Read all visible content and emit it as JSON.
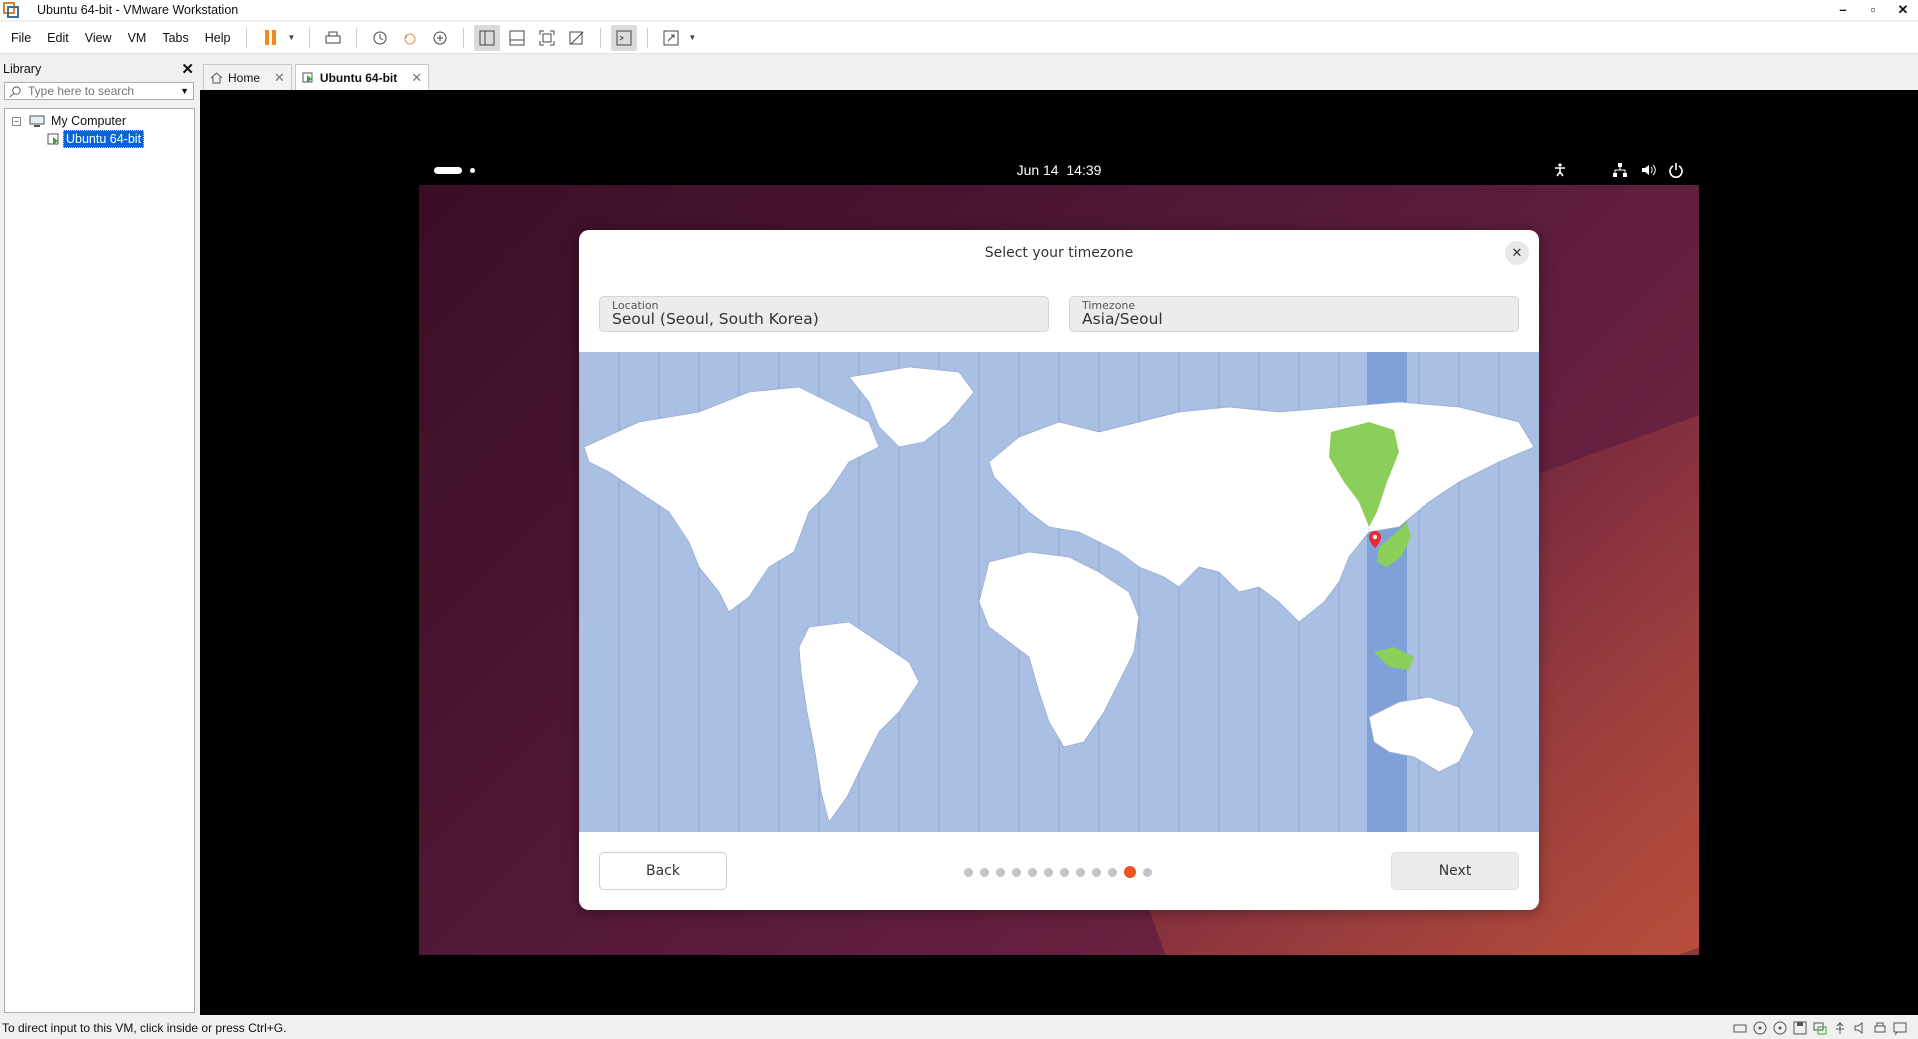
{
  "window": {
    "title": "Ubuntu 64-bit - VMware Workstation"
  },
  "menu": [
    "File",
    "Edit",
    "View",
    "VM",
    "Tabs",
    "Help"
  ],
  "library": {
    "title": "Library",
    "search_placeholder": "Type here to search",
    "tree": {
      "root": "My Computer",
      "child": "Ubuntu 64-bit"
    }
  },
  "tabs": [
    {
      "label": "Home"
    },
    {
      "label": "Ubuntu 64-bit"
    }
  ],
  "guest": {
    "topbar": {
      "date": "Jun 14",
      "time": "14:39"
    },
    "dialog": {
      "title": "Select your timezone",
      "location_label": "Location",
      "location_value": "Seoul (Seoul, South Korea)",
      "timezone_label": "Timezone",
      "timezone_value": "Asia/Seoul",
      "back_label": "Back",
      "next_label": "Next",
      "steps_total": 12,
      "steps_current": 11
    }
  },
  "status": {
    "message": "To direct input to this VM, click inside or press Ctrl+G."
  },
  "colors": {
    "accent": "#e95420",
    "selected": "#0a64d8",
    "map_ocean": "#a9bfe3",
    "map_highlight": "#7fa0d8",
    "map_zone_land": "#8bcf5a"
  }
}
